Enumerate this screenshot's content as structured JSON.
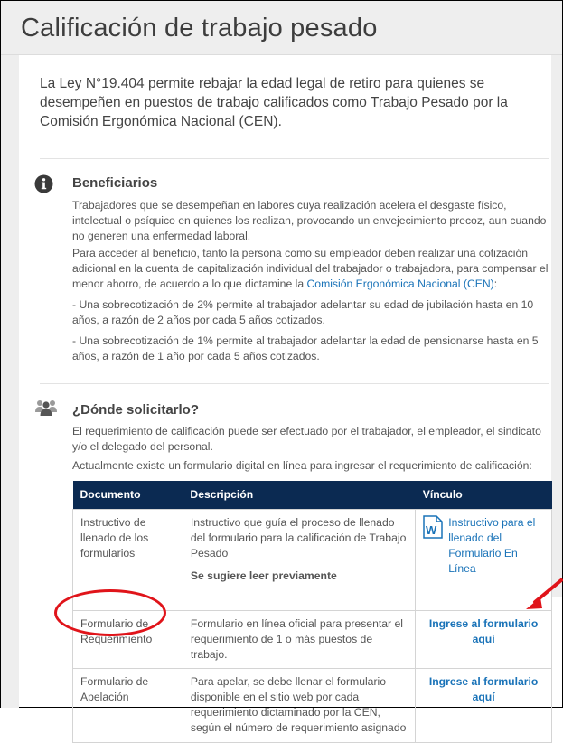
{
  "page": {
    "title": "Calificación de trabajo pesado",
    "intro": "La Ley N°19.404 permite rebajar la edad legal de retiro para quienes se desempeñen en puestos de trabajo calificados como Trabajo Pesado por la Comisión Ergonómica Nacional (CEN)."
  },
  "beneficiarios": {
    "icon": "info-icon",
    "title": "Beneficiarios",
    "p1": "Trabajadores que se desempeñan en labores cuya realización acelera el desgaste físico, intelectual o psíquico en quienes los realizan, provocando un envejecimiento precoz, aun cuando no generen una enfermedad laboral.",
    "p2_text": "Para acceder al beneficio, tanto la persona como su empleador deben realizar una cotización adicional en la cuenta de capitalización individual del trabajador o trabajadora, para compensar el menor ahorro, de acuerdo a lo que dictamine la ",
    "p2_link": "Comisión Ergonómica Nacional (CEN)",
    "p2_end": ":",
    "p3": "- Una sobrecotización de 2% permite al trabajador adelantar su edad de jubilación hasta en 10 años, a razón de 2 años por cada 5 años cotizados.",
    "p4": "- Una sobrecotización de 1% permite al trabajador adelantar la edad de pensionarse hasta en 5 años, a razón de 1 año por cada 5 años cotizados."
  },
  "donde": {
    "icon": "people-icon",
    "title": "¿Dónde solicitarlo?",
    "p1": "El requerimiento de calificación puede ser efectuado por el trabajador, el empleador, el sindicato y/o el delegado del personal.",
    "p2": "Actualmente existe un formulario digital en línea para ingresar el requerimiento de calificación:"
  },
  "table": {
    "headers": [
      "Documento",
      "Descripción",
      "Vínculo"
    ],
    "rows": [
      {
        "documento": "Instructivo de llenado de los formularios",
        "descripcion": "Instructivo que guía el proceso de llenado del formulario para la calificación de Trabajo Pesado",
        "nota": "Se sugiere leer previamente",
        "vinculo": "Instructivo para el llenado del Formulario En Línea",
        "vinculo_icon": "word-doc-icon"
      },
      {
        "documento": "Formulario de Requerimiento",
        "descripcion": "Formulario en línea oficial para presentar el requerimiento de 1 o más puestos de trabajo.",
        "vinculo": "Ingrese al formulario aquí"
      },
      {
        "documento": "Formulario de Apelación",
        "descripcion": "Para apelar, se debe llenar el formulario disponible en el sitio web por cada requerimiento dictaminado por la CEN, según el número de requerimiento asignado",
        "vinculo": "Ingrese al formulario aquí"
      }
    ]
  },
  "colors": {
    "header_bg": "#eeeeee",
    "table_header": "#0b2a52",
    "link": "#1a73b8",
    "annotation": "#e0141a"
  }
}
